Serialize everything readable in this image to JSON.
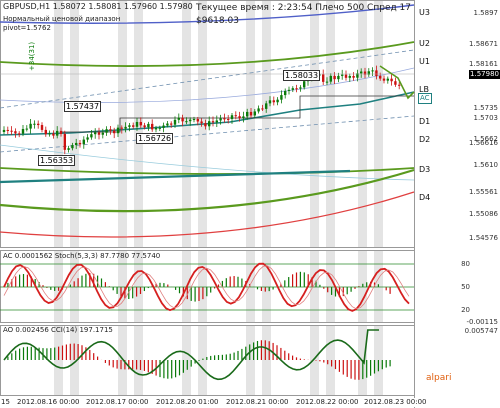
{
  "header": {
    "symbol_line": "GBPUSD,H1  1.58072 1.58081 1.57960 1.57980",
    "indicator_title": "Нормальный ценовой диапазон",
    "pivot_label": "pivot=1.5762",
    "status_line": "Текущее время : 2:23:54 Плечо 500 Спред 17",
    "balance": "$9618.03",
    "left_marker": "+34(31)"
  },
  "right_axis": {
    "price_ticks": [
      "1.5897",
      "1.58671",
      "1.58161",
      "1.57980",
      "1.5735",
      "1.5703",
      "1.5662",
      "1.56616",
      "1.5610",
      "1.55561",
      "1.55086",
      "1.54576"
    ],
    "current_price": "1.57980",
    "levels": [
      "U3",
      "U2",
      "U1",
      "LB",
      "D1",
      "D2",
      "D3",
      "D4"
    ],
    "ac_tag": "AC"
  },
  "chart_tags": [
    "1.58033",
    "1.57437",
    "1.56726",
    "1.56353"
  ],
  "panel_ac": {
    "title": "AC 0.0001562  Stoch(5,3,3) 87.7780 77.5740",
    "levels": [
      "80",
      "50",
      "20"
    ],
    "min_label": "-0.00115"
  },
  "panel_ao": {
    "title": "AO 0.002456  CCI(14) 197.1715",
    "top_label": "0.005747",
    "logo": "alpari"
  },
  "time_axis": [
    "15",
    "2012.08.16 00:00",
    "2012.08.17 00:00",
    "2012.08.20 01:00",
    "2012.08.21 00:00",
    "2012.08.22 00:00",
    "2012.08.23 00:00"
  ],
  "colors": {
    "bull": "#0a7a0a",
    "bear": "#cc1111",
    "band_green": "#5a9a1e",
    "center_teal": "#1f8080",
    "d4_red": "#e04040",
    "u3_blue": "#5060c8",
    "stoch_red": "#d62020",
    "cci_green": "#1a6a1a",
    "session_gray": "#e4e4e4"
  }
}
